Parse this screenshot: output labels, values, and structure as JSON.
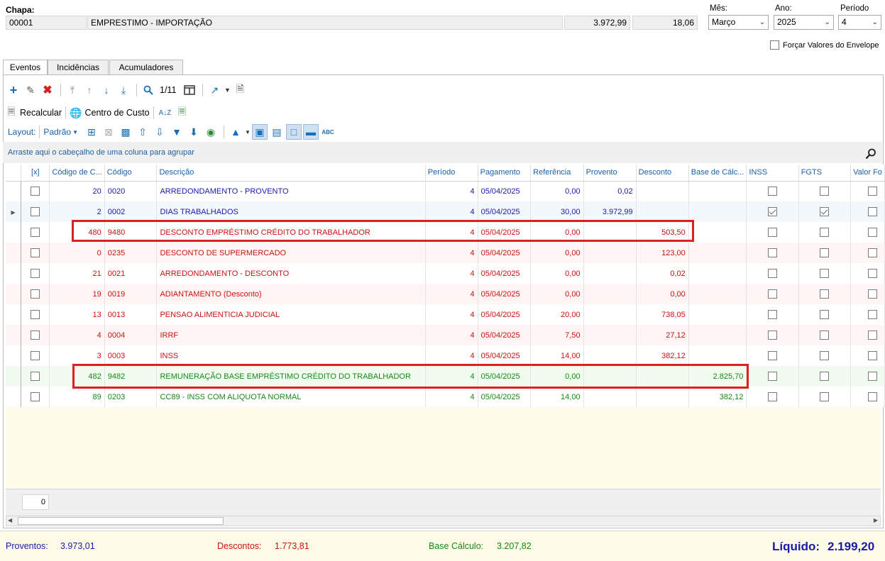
{
  "header": {
    "chapa_label": "Chapa:",
    "chapa_code": "00001",
    "chapa_name": "EMPRESTIMO - IMPORTAÇÃO",
    "value1": "3.972,99",
    "value2": "18,06",
    "mes_label": "Mês:",
    "mes_value": "Março",
    "ano_label": "Ano:",
    "ano_value": "2025",
    "periodo_label": "Período",
    "periodo_value": "4",
    "forcar_label": "Forçar Valores do Envelope"
  },
  "tabs": [
    {
      "label": "Eventos"
    },
    {
      "label": "Incidências"
    },
    {
      "label": "Acumuladores"
    }
  ],
  "toolbar": {
    "page_indicator": "1/11",
    "recalcular_label": "Recalcular",
    "centro_custo_label": "Centro de Custo",
    "layout_label": "Layout:",
    "layout_value": "Padrão"
  },
  "group_hint": "Arraste aqui o cabeçalho de uma coluna para agrupar",
  "columns": [
    "[x]",
    "Código de C...",
    "Código",
    "Descrição",
    "Período",
    "Pagamento",
    "Referência",
    "Provento",
    "Desconto",
    "Base de Cálc...",
    "INSS",
    "FGTS",
    "Valor Fo"
  ],
  "rows": [
    {
      "codc": "20",
      "cod": "0020",
      "desc": "ARREDONDAMENTO - PROVENTO",
      "per": "4",
      "pag": "05/04/2025",
      "ref": "0,00",
      "prov": "0,02",
      "desc_v": "",
      "base": "",
      "inss": false,
      "fgts": false,
      "color": "blue"
    },
    {
      "codc": "2",
      "cod": "0002",
      "desc": "DIAS TRABALHADOS",
      "per": "4",
      "pag": "05/04/2025",
      "ref": "30,00",
      "prov": "3.972,99",
      "desc_v": "",
      "base": "",
      "inss": true,
      "fgts": true,
      "color": "blue"
    },
    {
      "codc": "480",
      "cod": "9480",
      "desc": "DESCONTO EMPRÉSTIMO CRÉDITO DO TRABALHADOR",
      "per": "4",
      "pag": "05/04/2025",
      "ref": "0,00",
      "prov": "",
      "desc_v": "503,50",
      "base": "",
      "inss": false,
      "fgts": false,
      "color": "red"
    },
    {
      "codc": "0",
      "cod": "0235",
      "desc": "DESCONTO DE SUPERMERCADO",
      "per": "4",
      "pag": "05/04/2025",
      "ref": "0,00",
      "prov": "",
      "desc_v": "123,00",
      "base": "",
      "inss": false,
      "fgts": false,
      "color": "red"
    },
    {
      "codc": "21",
      "cod": "0021",
      "desc": "ARREDONDAMENTO - DESCONTO",
      "per": "4",
      "pag": "05/04/2025",
      "ref": "0,00",
      "prov": "",
      "desc_v": "0,02",
      "base": "",
      "inss": false,
      "fgts": false,
      "color": "red"
    },
    {
      "codc": "19",
      "cod": "0019",
      "desc": "ADIANTAMENTO (Desconto)",
      "per": "4",
      "pag": "05/04/2025",
      "ref": "0,00",
      "prov": "",
      "desc_v": "0,00",
      "base": "",
      "inss": false,
      "fgts": false,
      "color": "red"
    },
    {
      "codc": "13",
      "cod": "0013",
      "desc": "PENSAO ALIMENTICIA JUDICIAL",
      "per": "4",
      "pag": "05/04/2025",
      "ref": "20,00",
      "prov": "",
      "desc_v": "738,05",
      "base": "",
      "inss": false,
      "fgts": false,
      "color": "red"
    },
    {
      "codc": "4",
      "cod": "0004",
      "desc": "IRRF",
      "per": "4",
      "pag": "05/04/2025",
      "ref": "7,50",
      "prov": "",
      "desc_v": "27,12",
      "base": "",
      "inss": false,
      "fgts": false,
      "color": "red"
    },
    {
      "codc": "3",
      "cod": "0003",
      "desc": "INSS",
      "per": "4",
      "pag": "05/04/2025",
      "ref": "14,00",
      "prov": "",
      "desc_v": "382,12",
      "base": "",
      "inss": false,
      "fgts": false,
      "color": "red"
    },
    {
      "codc": "482",
      "cod": "9482",
      "desc": "REMUNERAÇÃO BASE EMPRÉSTIMO CRÉDITO DO TRABALHADOR",
      "per": "4",
      "pag": "05/04/2025",
      "ref": "0,00",
      "prov": "",
      "desc_v": "",
      "base": "2.825,70",
      "inss": false,
      "fgts": false,
      "color": "green"
    },
    {
      "codc": "89",
      "cod": "0203",
      "desc": "CC89 - INSS COM ALIQUOTA NORMAL",
      "per": "4",
      "pag": "05/04/2025",
      "ref": "14,00",
      "prov": "",
      "desc_v": "",
      "base": "382,12",
      "inss": false,
      "fgts": false,
      "color": "green"
    }
  ],
  "grid_footer_count": "0",
  "totals": {
    "proventos_label": "Proventos:",
    "proventos_value": "3.973,01",
    "descontos_label": "Descontos:",
    "descontos_value": "1.773,81",
    "base_label": "Base Cálculo:",
    "base_value": "3.207,82",
    "liquido_label": "Líquido:",
    "liquido_value": "2.199,20"
  },
  "colors": {
    "accent_blue": "#1c5fa7",
    "provento_blue": "#1a1aaa",
    "desconto_red": "#cc1111",
    "base_green": "#168a16",
    "highlight_red": "#e0201e"
  }
}
